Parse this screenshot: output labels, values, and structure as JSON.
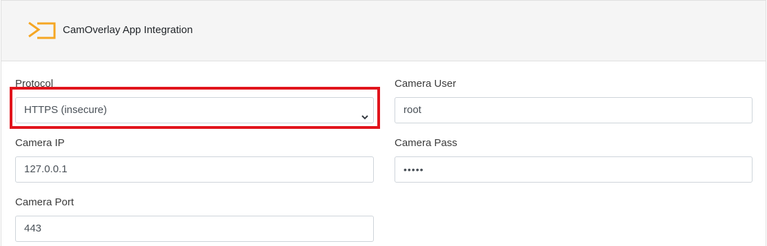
{
  "header": {
    "title": "CamOverlay App Integration",
    "logo_icon": "camoverlay-logo-icon",
    "logo_color": "#f5a623"
  },
  "form": {
    "protocol": {
      "label": "Protocol",
      "selected": "HTTPS (insecure)",
      "icon": "chevron-down-icon"
    },
    "camera_ip": {
      "label": "Camera IP",
      "value": "127.0.0.1"
    },
    "camera_port": {
      "label": "Camera Port",
      "value": "443"
    },
    "camera_user": {
      "label": "Camera User",
      "value": "root"
    },
    "camera_pass": {
      "label": "Camera Pass",
      "value": "•••••"
    }
  },
  "highlight": {
    "color": "#e1141c"
  }
}
